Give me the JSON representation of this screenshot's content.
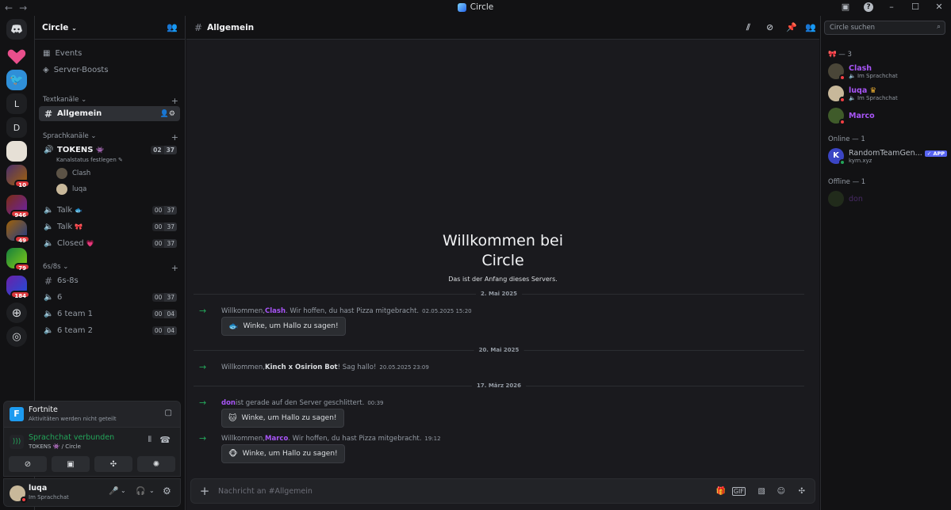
{
  "window": {
    "title": "Circle"
  },
  "server": {
    "name": "Circle",
    "nav": [
      "Events",
      "Server-Boosts"
    ],
    "badges": [
      "10",
      "946",
      "49",
      "79",
      "184"
    ],
    "rail_letters": [
      "L",
      "D"
    ]
  },
  "categories": {
    "text": "Textkanäle",
    "voice": "Sprachkanäle",
    "sixes": "6s/8s"
  },
  "channels": {
    "allgemein": "Allgemein",
    "tokens": {
      "name": "TOKENS",
      "status": "Kanalstatus festlegen",
      "c1": "02",
      "c2": "37",
      "users": [
        "Clash",
        "luqa"
      ]
    },
    "talk1": {
      "name": "Talk",
      "c1": "00",
      "c2": "37"
    },
    "talk2": {
      "name": "Talk",
      "c1": "00",
      "c2": "37"
    },
    "closed": {
      "name": "Closed",
      "c1": "00",
      "c2": "37"
    },
    "sixeight": "6s-8s",
    "six": {
      "name": "6",
      "c1": "00",
      "c2": "37"
    },
    "team1": {
      "name": "6 team 1",
      "c1": "00",
      "c2": "04"
    },
    "team2": {
      "name": "6 team 2",
      "c1": "00",
      "c2": "04"
    }
  },
  "activity": {
    "game": "Fortnite",
    "sub": "Aktivitäten werden nicht geteilt"
  },
  "voice": {
    "status": "Sprachchat verbunden",
    "channel": "TOKENS",
    "server": "/ Circle"
  },
  "user": {
    "name": "luqa",
    "status": "Im Sprachchat"
  },
  "main": {
    "channel": "Allgemein",
    "welcome_line1": "Willkommen bei",
    "welcome_line2": "Circle",
    "welcome_sub": "Das ist der Anfang dieses Servers.",
    "composer_placeholder": "Nachricht an #Allgemein",
    "messages": [
      {
        "date": "2. Mai 2025",
        "pre": "Willkommen, ",
        "name": "Clash",
        "post": ". Wir hoffen, du hast Pizza mitgebracht.",
        "ts": "02.05.2025 15:20",
        "wave": "Winke, um Hallo zu sagen!"
      },
      {
        "date": "20. Mai 2025",
        "pre": "Willkommen, ",
        "name": "Kinch x Osirion Bot",
        "post": "! Sag hallo!",
        "ts": "20.05.2025 23:09"
      },
      {
        "date": "17. März 2026",
        "pre": "",
        "name": "don",
        "post": " ist gerade auf den Server geschlittert.",
        "ts": "00:39",
        "wave": "Winke, um Hallo zu sagen!"
      },
      {
        "pre": "Willkommen, ",
        "name": "Marco",
        "post": ". Wir hoffen, du hast Pizza mitgebracht.",
        "ts": "19:12",
        "wave": "Winke, um Hallo zu sagen!"
      }
    ]
  },
  "members": {
    "search_placeholder": "Circle suchen",
    "group1": "— 3",
    "online": "Online — 1",
    "offline": "Offline — 1",
    "list": [
      {
        "name": "Clash",
        "status": "Im Sprachchat"
      },
      {
        "name": "luqa",
        "status": "Im Sprachchat"
      },
      {
        "name": "Marco"
      },
      {
        "name": "RandomTeamGen...",
        "status": "kyrn.xyz",
        "tag": "APP"
      },
      {
        "name": "don"
      }
    ]
  },
  "colors": {
    "accent": "#a855f7",
    "online": "#23a55a",
    "dnd": "#f23f43",
    "app_tag": "#5865f2"
  }
}
